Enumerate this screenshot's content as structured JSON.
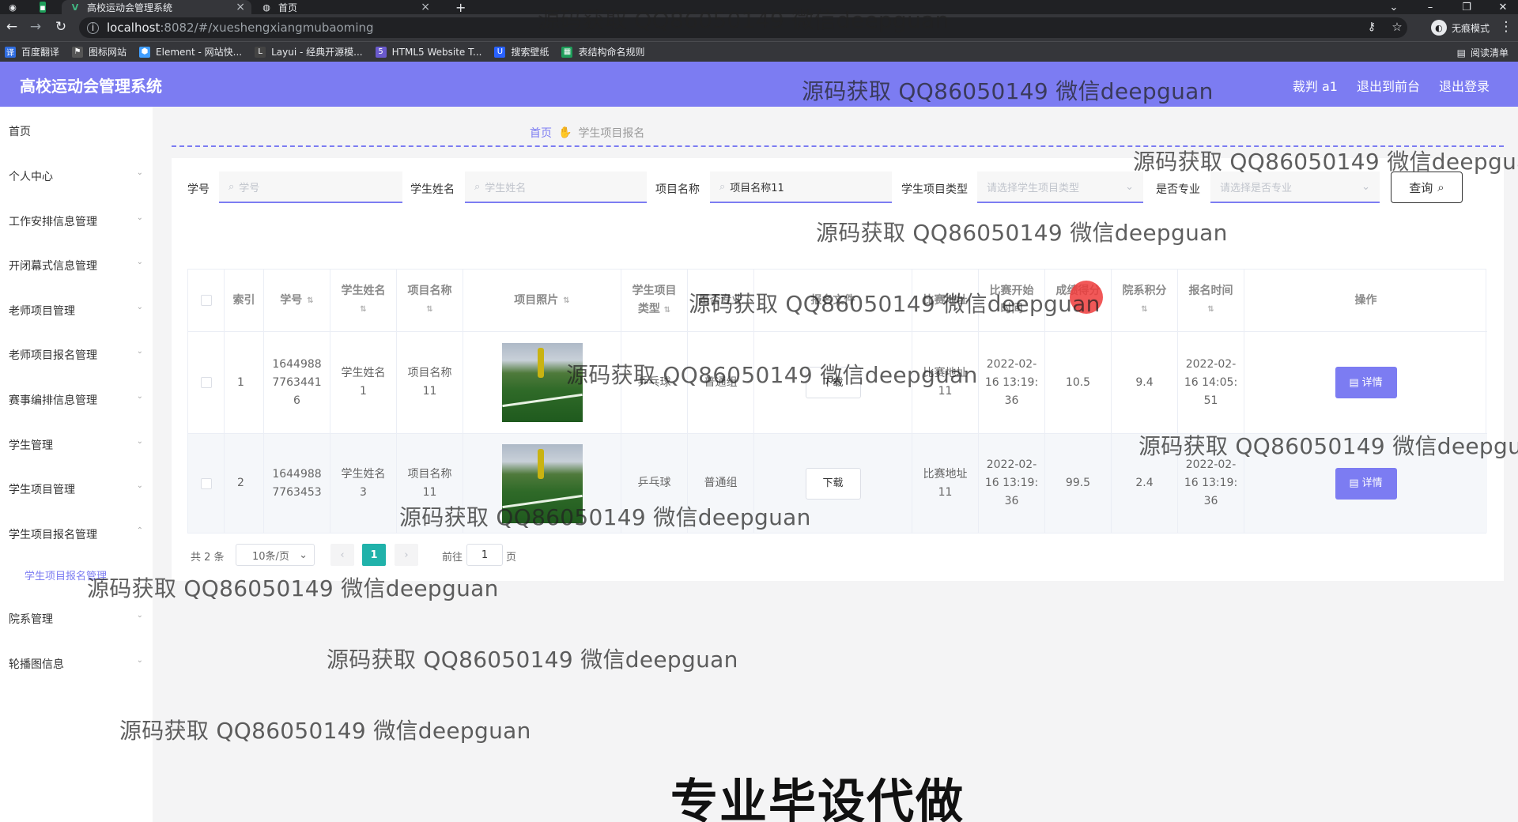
{
  "browser": {
    "tabs": [
      {
        "label": "高校运动会管理系统"
      },
      {
        "label": "首页"
      }
    ],
    "url_host": "localhost",
    "url_path": ":8082/#/xueshengxiangmubaoming",
    "profile_label": "无痕模式",
    "bookmarks": [
      "百度翻译",
      "图标网站",
      "Element - 网站快...",
      "Layui - 经典开源模...",
      "HTML5 Website T...",
      "搜索壁纸",
      "表结构命名规则"
    ],
    "reading_list": "阅读清单"
  },
  "app": {
    "title": "高校运动会管理系统",
    "header_menu": [
      "裁判 a1",
      "退出到前台",
      "退出登录"
    ]
  },
  "sidebar": {
    "items": [
      {
        "label": "首页"
      },
      {
        "label": "个人中心"
      },
      {
        "label": "工作安排信息管理"
      },
      {
        "label": "开闭幕式信息管理"
      },
      {
        "label": "老师项目管理"
      },
      {
        "label": "老师项目报名管理"
      },
      {
        "label": "赛事编排信息管理"
      },
      {
        "label": "学生管理"
      },
      {
        "label": "学生项目管理"
      },
      {
        "label": "学生项目报名管理"
      },
      {
        "label": "院系管理"
      },
      {
        "label": "轮播图信息"
      }
    ],
    "active_sub": "学生项目报名管理"
  },
  "breadcrumb": {
    "home": "首页",
    "current": "学生项目报名"
  },
  "filters": {
    "xuehao": {
      "label": "学号",
      "placeholder": "学号"
    },
    "name": {
      "label": "学生姓名",
      "placeholder": "学生姓名"
    },
    "project": {
      "label": "项目名称",
      "value": "项目名称11"
    },
    "type": {
      "label": "学生项目类型",
      "placeholder": "请选择学生项目类型"
    },
    "pro": {
      "label": "是否专业",
      "placeholder": "请选择是否专业"
    },
    "query_label": "查询"
  },
  "table": {
    "headers": {
      "index": "索引",
      "xuehao": "学号",
      "name": "学生姓名",
      "project": "项目名称",
      "photo": "项目照片",
      "type_l1": "学生项目",
      "type_l2": "类型",
      "pro": "是否专业",
      "file": "报名文件",
      "addr": "比赛地址",
      "start_l1": "比赛开始",
      "start_l2": "时间",
      "score": "成绩得分",
      "dept": "院系积分",
      "time": "报名时间",
      "op": "操作"
    },
    "rows": [
      {
        "index": "1",
        "xuehao": "1644988\n7763441\n6",
        "name": "学生姓名\n1",
        "project": "项目名称\n11",
        "type": "乒乓球",
        "pro": "普通组",
        "file_btn": "下载",
        "addr": "比赛地址\n11",
        "start": "2022-02-\n16 13:19:\n36",
        "score": "10.5",
        "dept": "9.4",
        "time": "2022-02-\n16 14:05:\n51",
        "detail": "详情"
      },
      {
        "index": "2",
        "xuehao": "1644988\n7763453",
        "name": "学生姓名\n3",
        "project": "项目名称\n11",
        "type": "乒乓球",
        "pro": "普通组",
        "file_btn": "下载",
        "addr": "比赛地址\n11",
        "start": "2022-02-\n16 13:19:\n36",
        "score": "99.5",
        "dept": "2.4",
        "time": "2022-02-\n16 13:19:\n36",
        "detail": "详情"
      }
    ]
  },
  "pagination": {
    "total": "共 2 条",
    "size": "10条/页",
    "current": "1",
    "goto": "前往",
    "page_input": "1",
    "page_suffix": "页"
  },
  "watermark": "源码获取 QQ86050149 微信deepguan",
  "caption": "专业毕设代做",
  "colors": {
    "accent": "#7c7cf2",
    "pager_active": "#20b2aa"
  }
}
